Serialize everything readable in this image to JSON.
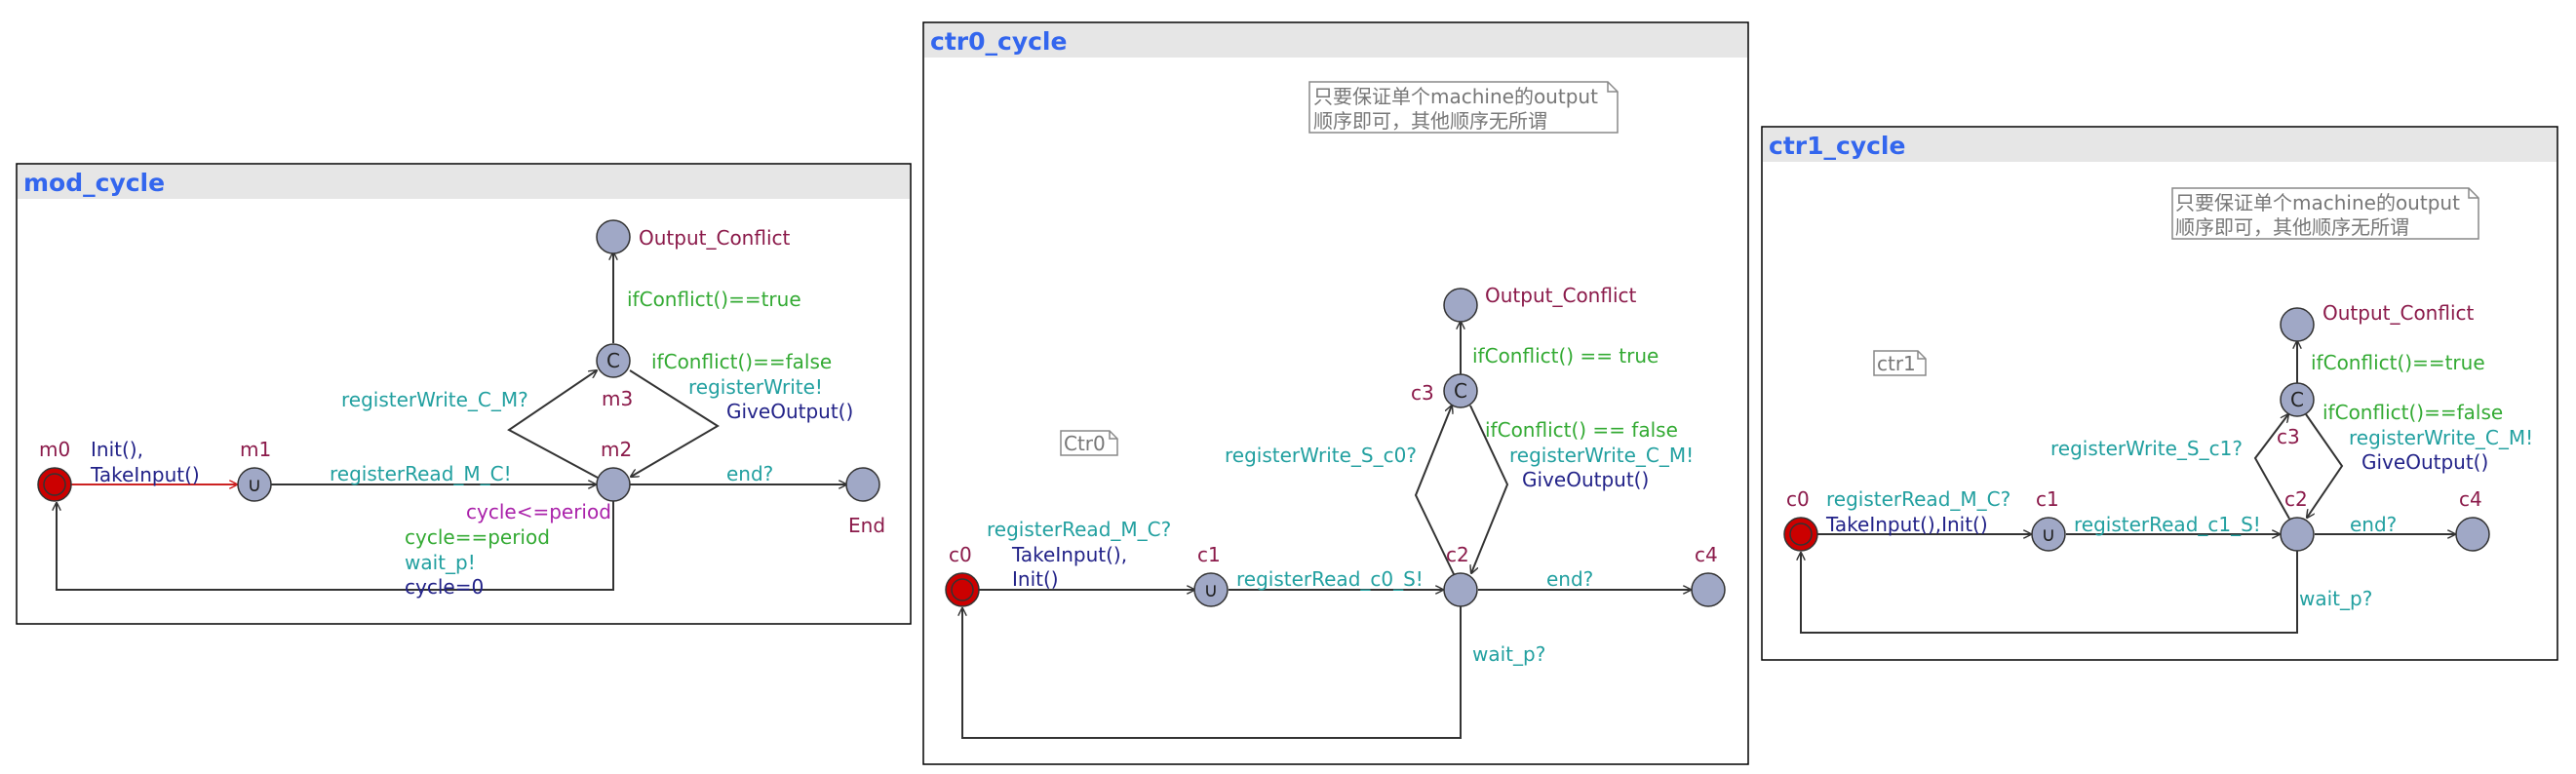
{
  "colors": {
    "panel_border": "#000000",
    "title_bar": "#e6e6e6",
    "title_text": "#3366ee",
    "location_fill": "#a0a8c6",
    "initial_fill": "#cc0000",
    "location_name": "#8b1a4a",
    "sync": "#22a0a0",
    "guard": "#33aa33",
    "update": "#222288",
    "invariant": "#aa22aa",
    "edge": "#333333",
    "edge_active": "#cc2222",
    "comment_text": "#777777"
  },
  "mod_cycle": {
    "title": "mod_cycle",
    "locations": {
      "m0": "m0",
      "m1": "m1",
      "m2": "m2",
      "m3": "m3",
      "out": "Output_Conflict",
      "end": "End"
    },
    "committed_mark": "C",
    "urgent_mark": "∪",
    "labels": {
      "init": "Init(),",
      "take_input": "TakeInput()",
      "reg_read": "registerRead_M_C!",
      "end_sync": "end?",
      "reg_write": "registerWrite_C_M?",
      "if_false": "ifConflict()==false",
      "reg_write_send": "registerWrite!",
      "give_output": "GiveOutput()",
      "if_true": "ifConflict()==true",
      "invariant": "cycle<=period",
      "guard_period": "cycle==period",
      "wait_sync": "wait_p!",
      "reset": "cycle=0"
    }
  },
  "ctr0_cycle": {
    "title": "ctr0_cycle",
    "comment": [
      "只要保证单个machine的output",
      "顺序即可，其他顺序无所谓"
    ],
    "tag": "Ctr0",
    "locations": {
      "c0": "c0",
      "c1": "c1",
      "c2": "c2",
      "c3": "c3",
      "c4": "c4",
      "out": "Output_Conflict"
    },
    "urgent_mark": "∪",
    "labels": {
      "reg_read": "registerRead_M_C?",
      "take_input": "TakeInput(),",
      "init": "Init()",
      "reg_read_send": "registerRead_c0_S!",
      "end_sync": "end?",
      "reg_write": "registerWrite_S_c0?",
      "if_false": "ifConflict() == false",
      "reg_write_send": "registerWrite_C_M!",
      "give_output": "GiveOutput()",
      "if_true": "ifConflict() == true",
      "wait_sync": "wait_p?"
    }
  },
  "ctr1_cycle": {
    "title": "ctr1_cycle",
    "comment": [
      "只要保证单个machine的output",
      "顺序即可，其他顺序无所谓"
    ],
    "tag": "ctr1",
    "locations": {
      "c0": "c0",
      "c1": "c1",
      "c2": "c2",
      "c3": "c3",
      "c4": "c4",
      "out": "Output_Conflict"
    },
    "urgent_mark": "∪",
    "labels": {
      "reg_read": "registerRead_M_C?",
      "take_input_init": "TakeInput(),Init()",
      "reg_read_send": "registerRead_c1_S!",
      "end_sync": "end?",
      "reg_write": "registerWrite_S_c1?",
      "if_false": "ifConflict()==false",
      "reg_write_send": "registerWrite_C_M!",
      "give_output": "GiveOutput()",
      "if_true": "ifConflict()==true",
      "wait_sync": "wait_p?"
    }
  }
}
